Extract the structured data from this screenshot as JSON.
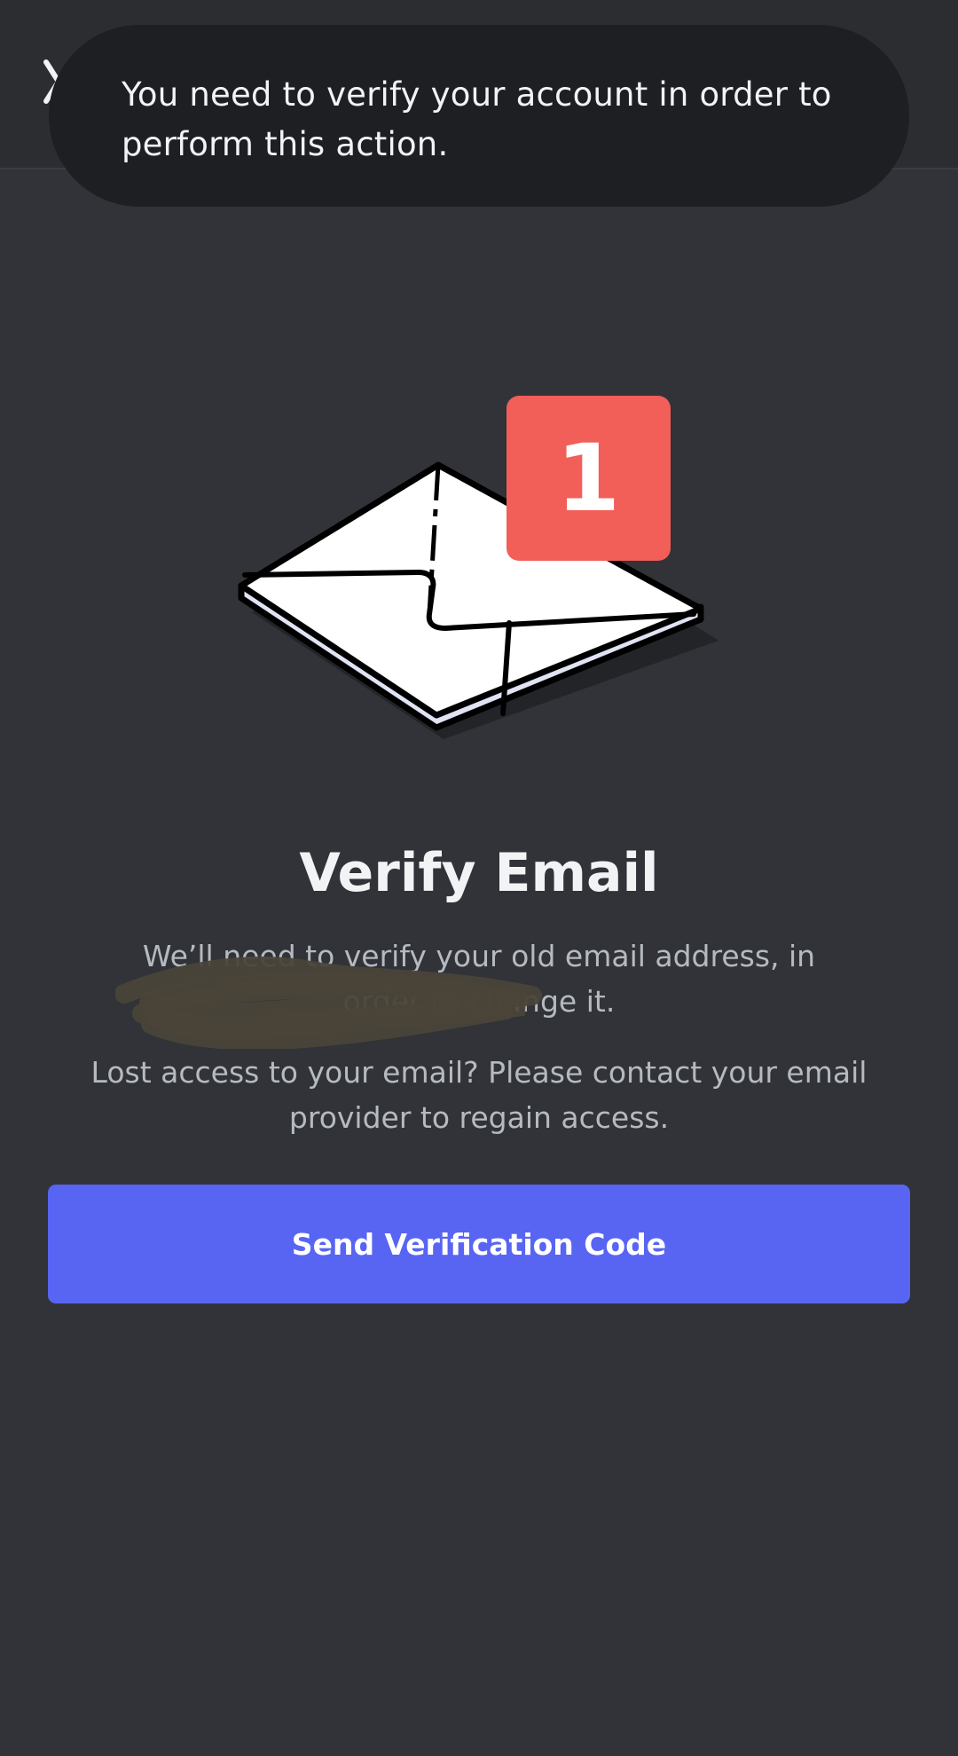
{
  "toast": {
    "message": "You need to verify your account in order to perform this action."
  },
  "header": {
    "back_icon": "back-arrow-icon"
  },
  "illustration": {
    "icon": "envelope-icon",
    "badge_count": "1",
    "badge_color": "#f25e58"
  },
  "main": {
    "title": "Verify Email",
    "description": "We’ll need to verify your old email address, in order to change it.",
    "help_text": "Lost access to your email? Please contact your email provider to regain access."
  },
  "actions": {
    "send_code_label": "Send Verification Code",
    "accent_color": "#5865f2"
  }
}
